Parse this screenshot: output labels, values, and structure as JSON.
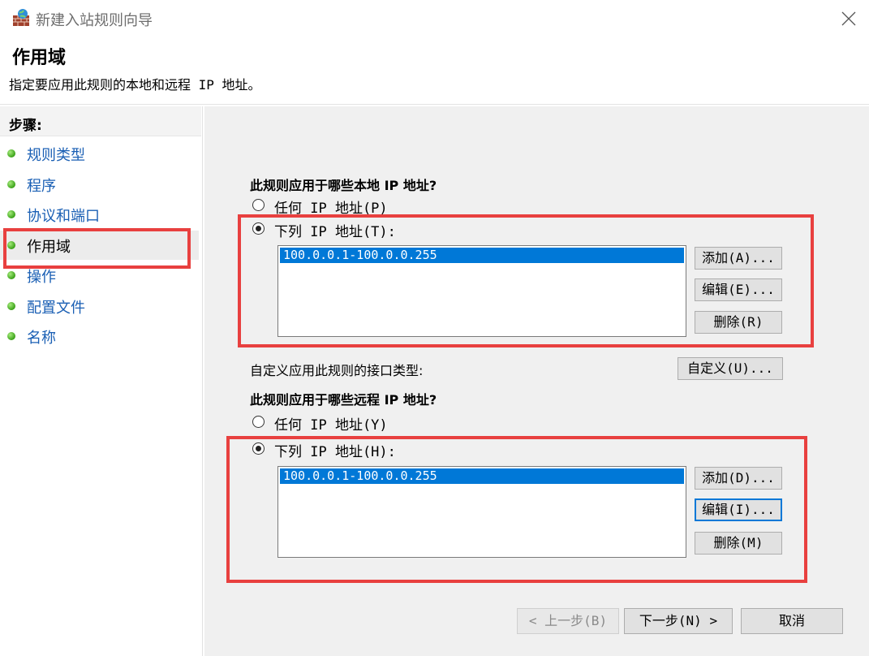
{
  "window": {
    "title": "新建入站规则向导",
    "icon": "firewall-icon",
    "close_icon": "close-icon"
  },
  "header": {
    "title": "作用域",
    "description": "指定要应用此规则的本地和远程 IP 地址。"
  },
  "steps": {
    "title": "步骤:",
    "items": [
      {
        "label": "规则类型"
      },
      {
        "label": "程序"
      },
      {
        "label": "协议和端口"
      },
      {
        "label": "作用域",
        "current": true
      },
      {
        "label": "操作"
      },
      {
        "label": "配置文件"
      },
      {
        "label": "名称"
      }
    ]
  },
  "local": {
    "question": "此规则应用于哪些本地 IP 地址?",
    "option_any": "任何 IP 地址(P)",
    "option_list": "下列 IP 地址(T):",
    "selected": "list",
    "addresses": [
      "100.0.0.1-100.0.0.255"
    ],
    "add_label": "添加(A)...",
    "edit_label": "编辑(E)...",
    "remove_label": "删除(R)"
  },
  "interface": {
    "label": "自定义应用此规则的接口类型:",
    "button_label": "自定义(U)..."
  },
  "remote": {
    "question": "此规则应用于哪些远程 IP 地址?",
    "option_any": "任何 IP 地址(Y)",
    "option_list": "下列 IP 地址(H):",
    "selected": "list",
    "addresses": [
      "100.0.0.1-100.0.0.255"
    ],
    "add_label": "添加(D)...",
    "edit_label": "编辑(I)...",
    "remove_label": "删除(M)"
  },
  "footer": {
    "back_label": "< 上一步(B)",
    "next_label": "下一步(N) >",
    "cancel_label": "取消"
  },
  "colors": {
    "annotation": "#e8403f",
    "selection": "#0078d7",
    "step_link": "#1a5fb4",
    "step_dot": "#3aa118"
  }
}
